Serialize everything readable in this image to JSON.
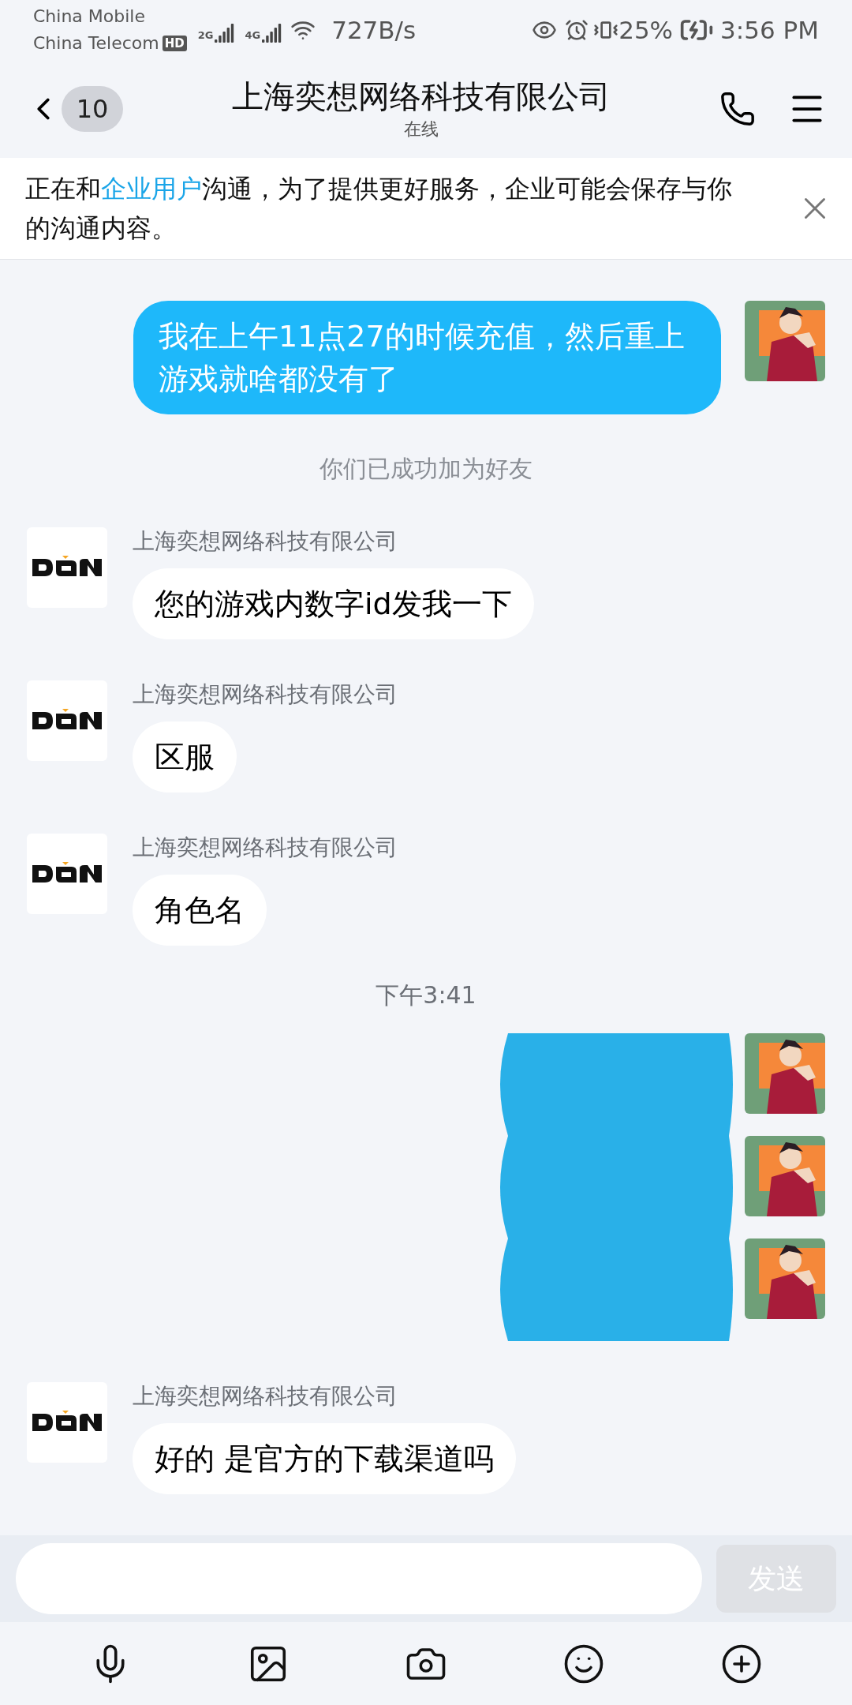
{
  "status_bar": {
    "carriers": [
      "China Mobile",
      "China Telecom"
    ],
    "hd_badge": "HD",
    "network_badges": [
      "2G",
      "4G"
    ],
    "speed": "727B/s",
    "battery": "25%",
    "time": "3:56 PM"
  },
  "header": {
    "unread_count": "10",
    "title": "上海奕想网络科技有限公司",
    "status": "在线"
  },
  "notice": {
    "prefix": "正在和",
    "link": "企业用户",
    "suffix": "沟通，为了提供更好服务，企业可能会保存与你的沟通内容。"
  },
  "messages": [
    {
      "kind": "sent",
      "text": "我在上午11点27的时候充值，然后重上游戏就啥都没有了"
    },
    {
      "kind": "system",
      "text": "你们已成功加为好友"
    },
    {
      "kind": "received",
      "sender": "上海奕想网络科技有限公司",
      "text": "您的游戏内数字id发我一下"
    },
    {
      "kind": "received",
      "sender": "上海奕想网络科技有限公司",
      "text": "区服"
    },
    {
      "kind": "received",
      "sender": "上海奕想网络科技有限公司",
      "text": "角色名"
    },
    {
      "kind": "time",
      "text": "下午3:41"
    },
    {
      "kind": "redacted"
    },
    {
      "kind": "redacted"
    },
    {
      "kind": "redacted"
    },
    {
      "kind": "received",
      "sender": "上海奕想网络科技有限公司",
      "text": "好的 是官方的下载渠道吗"
    }
  ],
  "composer": {
    "send_label": "发送",
    "send_disabled": true
  }
}
